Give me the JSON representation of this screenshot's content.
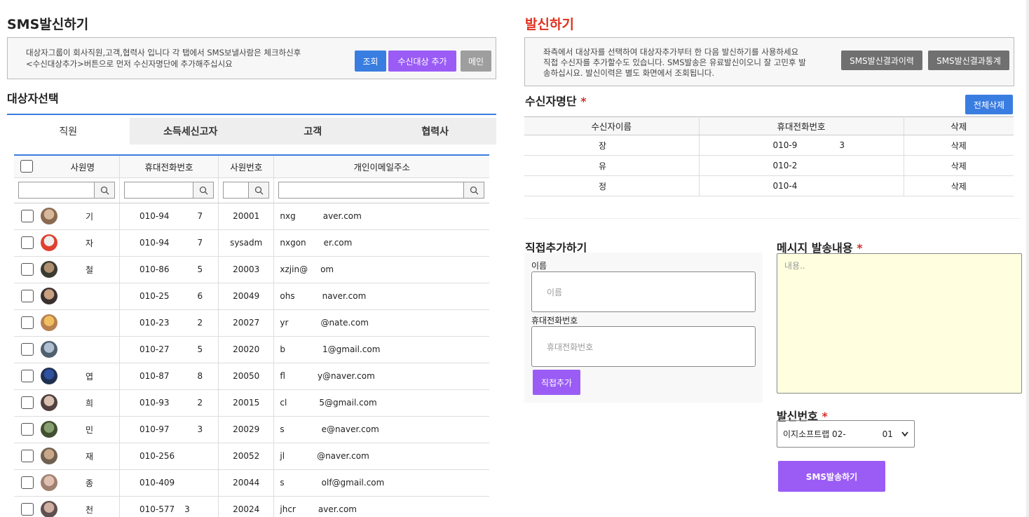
{
  "left": {
    "title": "SMS발신하기",
    "notice_line1": "대상자그룹이 회사직원,고객,협력사 입니다 각 탭에서 SMS보낼사람은 체크하신후",
    "notice_line2": "<수신대상추가>버튼으로 먼저 수신자명단에 추가해주십시요",
    "btn_search": "조회",
    "btn_add_target": "수신대상 추가",
    "btn_main": "메인",
    "section_title": "대상자선택",
    "tabs": [
      "직원",
      "소득세신고자",
      "고객",
      "협력사"
    ],
    "columns": [
      "사원명",
      "휴대전화번호",
      "사원번호",
      "개인이메일주소"
    ],
    "rows": [
      {
        "name": "기",
        "phone": "010-94",
        "phone_tail": "7",
        "empno": "20001",
        "email": "nxg",
        "email_tail": "aver.com"
      },
      {
        "name": "자",
        "phone": "010-94",
        "phone_tail": "7",
        "empno": "sysadm",
        "email": "nxgon",
        "email_tail": "er.com"
      },
      {
        "name": "철",
        "phone": "010-86",
        "phone_tail": "5",
        "empno": "20003",
        "email": "xzjin@",
        "email_tail": "om"
      },
      {
        "name": "",
        "phone": "010-25",
        "phone_tail": "6",
        "empno": "20049",
        "email": "ohs",
        "email_tail": "naver.com"
      },
      {
        "name": "",
        "phone": "010-23",
        "phone_tail": "2",
        "empno": "20027",
        "email": "yr",
        "email_tail": "@nate.com"
      },
      {
        "name": "",
        "phone": "010-27",
        "phone_tail": "5",
        "empno": "20020",
        "email": "b",
        "email_tail": "1@gmail.com"
      },
      {
        "name": "엽",
        "phone": "010-87",
        "phone_tail": "8",
        "empno": "20050",
        "email": "fl",
        "email_tail": "y@naver.com"
      },
      {
        "name": "희",
        "phone": "010-93",
        "phone_tail": "2",
        "empno": "20015",
        "email": "cl",
        "email_tail": "5@gmail.com"
      },
      {
        "name": "민",
        "phone": "010-97",
        "phone_tail": "3",
        "empno": "20029",
        "email": "s",
        "email_tail": "e@naver.com"
      },
      {
        "name": "재",
        "phone": "010-256",
        "phone_tail": "",
        "empno": "20052",
        "email": "jl",
        "email_tail": "@naver.com"
      },
      {
        "name": "종",
        "phone": "010-409",
        "phone_tail": "",
        "empno": "20044",
        "email": "s",
        "email_tail": "olf@gmail.com"
      },
      {
        "name": "천",
        "phone": "010-577",
        "phone_tail": "3",
        "empno": "20024",
        "email": "jhcr",
        "email_tail": "aver.com"
      }
    ]
  },
  "right": {
    "title": "발신하기",
    "notice_line1": "좌측에서 대상자를 선택하여 대상자추가부터 한 다음 발신하기를 사용하세요",
    "notice_line2": "직접 수신자를 추가할수도 있습니다. SMS발송은 유료발신이오니 잘 고민후 발",
    "notice_line3": "송하십시요. 발신이력은 별도 화면에서 조회됩니다.",
    "btn_history": "SMS발신결과이력",
    "btn_stats": "SMS발신결과통계",
    "recipients_title": "수신자명단",
    "btn_delete_all": "전체삭제",
    "recipient_columns": [
      "수신자이름",
      "휴대전화번호",
      "삭제"
    ],
    "recipients": [
      {
        "name": "장",
        "phone": "010-9",
        "phone_tail": "3",
        "action": "삭제"
      },
      {
        "name": "유",
        "phone": "010-2",
        "phone_tail": "",
        "action": "삭제"
      },
      {
        "name": "정",
        "phone": "010-4",
        "phone_tail": "",
        "action": "삭제"
      }
    ],
    "direct_add_title": "직접추가하기",
    "name_label": "이름",
    "name_placeholder": "이름",
    "phone_label": "휴대전화번호",
    "phone_placeholder": "휴대전화번호",
    "btn_direct_add": "직접추가",
    "message_title": "메시지 발송내용",
    "message_placeholder": "내용..",
    "sender_title": "발신번호",
    "sender_selected": "이지소프트랩 02-",
    "sender_selected_tail": "01",
    "btn_send": "SMS발송하기"
  }
}
